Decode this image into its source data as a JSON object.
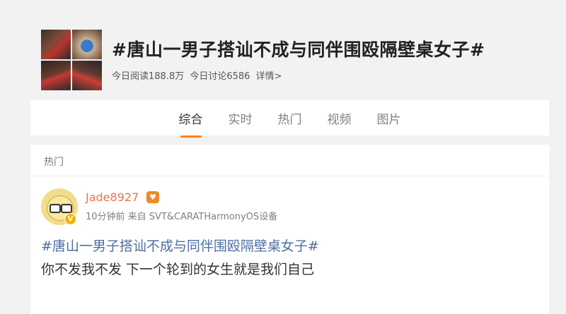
{
  "topic": {
    "title": "#唐山一男子搭讪不成与同伴围殴隔壁桌女子#",
    "stats_read": "今日阅读188.8万",
    "stats_discuss": "今日讨论6586",
    "details_link": "详情>"
  },
  "tabs": [
    {
      "label": "综合",
      "active": true
    },
    {
      "label": "实时",
      "active": false
    },
    {
      "label": "热门",
      "active": false
    },
    {
      "label": "视频",
      "active": false
    },
    {
      "label": "图片",
      "active": false
    }
  ],
  "feed": {
    "section_label": "热门",
    "post": {
      "username": "Jade8927",
      "meta": "10分钟前 来自 SVT&CARATHarmonyOS设备",
      "topic_link": "#唐山一男子搭讪不成与同伴围殴隔壁桌女子#",
      "body": "你不发我不发 下一个轮到的女生就是我们自己"
    }
  },
  "colors": {
    "accent": "#ff8200",
    "username": "#eb7350",
    "topic_link": "#4e6ea0"
  }
}
